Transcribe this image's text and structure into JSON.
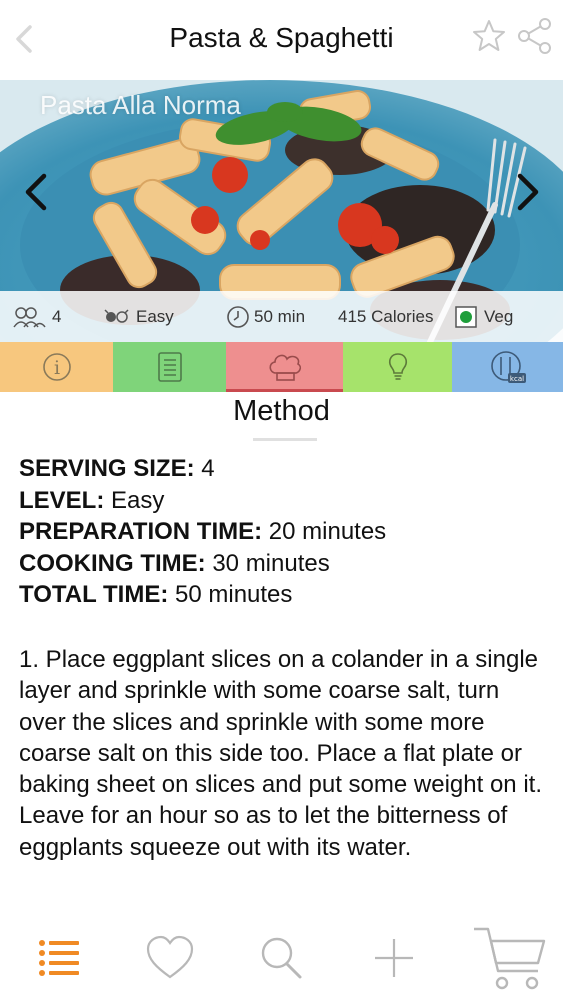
{
  "header": {
    "title": "Pasta & Spaghetti",
    "back_icon": "chevron-left-icon",
    "favorite_icon": "star-icon",
    "share_icon": "share-icon"
  },
  "hero": {
    "caption": "Pasta Alla Norma",
    "prev_icon": "chevron-left-icon",
    "next_icon": "chevron-right-icon"
  },
  "info": {
    "servings": "4",
    "difficulty": "Easy",
    "time": "50 min",
    "calories": "415 Calories",
    "diet": "Veg"
  },
  "tabs": [
    {
      "name": "info",
      "icon": "info-icon",
      "color": "#f7c77e"
    },
    {
      "name": "ingredients",
      "icon": "list-icon",
      "color": "#7fd47a"
    },
    {
      "name": "method",
      "icon": "chef-hat-icon",
      "color": "#ee8f8f",
      "active": true
    },
    {
      "name": "tips",
      "icon": "lightbulb-icon",
      "color": "#a6e36b"
    },
    {
      "name": "nutrition",
      "icon": "kcal-icon",
      "color": "#86b7e6"
    }
  ],
  "section": {
    "title": "Method"
  },
  "meta": {
    "serving_label": "SERVING SIZE:",
    "serving_value": "4",
    "level_label": "LEVEL:",
    "level_value": "Easy",
    "prep_label": "PREPARATION TIME:",
    "prep_value": "20 minutes",
    "cook_label": "COOKING TIME:",
    "cook_value": "30 minutes",
    "total_label": "TOTAL TIME:",
    "total_value": "50 minutes"
  },
  "steps": [
    "1. Place eggplant slices on a colander in a single layer and sprinkle with some coarse salt, turn over the slices and sprinkle with some more coarse salt on this side too. Place a flat plate or baking sheet on slices and put some weight on it. Leave for an hour so as to let the bitterness of eggplants squeeze out with its water."
  ],
  "bottom_nav": [
    {
      "name": "menu",
      "icon": "list-icon",
      "active": true
    },
    {
      "name": "favorites",
      "icon": "heart-icon"
    },
    {
      "name": "search",
      "icon": "search-icon"
    },
    {
      "name": "add",
      "icon": "plus-icon"
    },
    {
      "name": "cart",
      "icon": "cart-icon"
    }
  ],
  "colors": {
    "accent": "#f08a24",
    "active_tab": "#c94a4f",
    "icon_gray": "#bdbdbd"
  }
}
